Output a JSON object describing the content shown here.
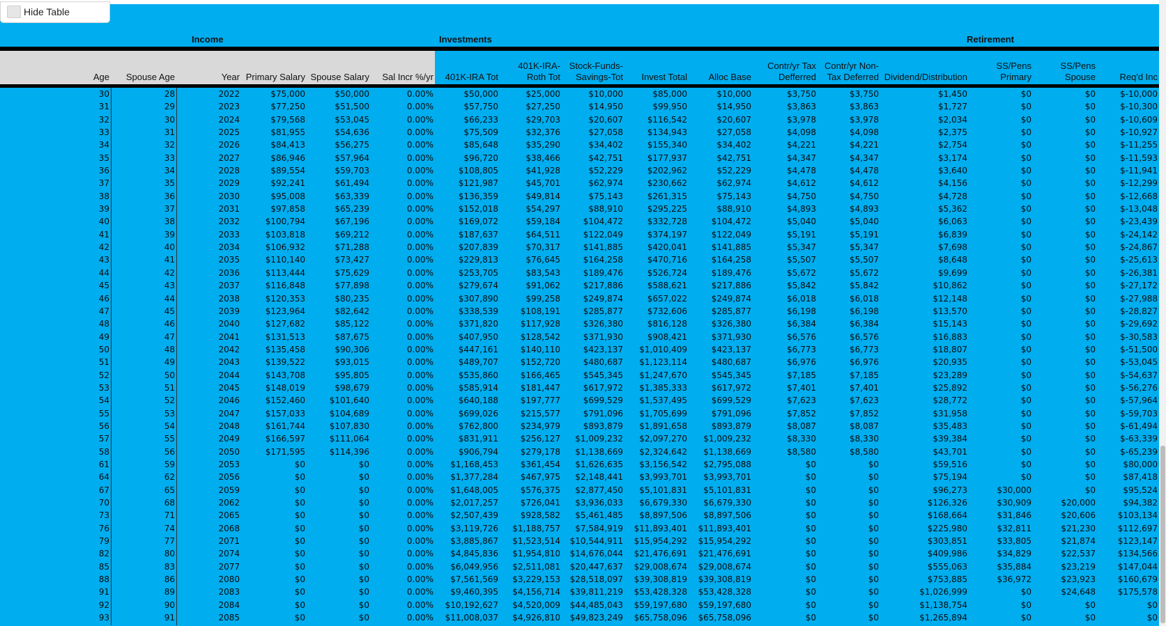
{
  "toolbar": {
    "hide_table_label": "Hide Table"
  },
  "sections": {
    "income": "Income",
    "investments": "Investments",
    "retirement": "Retirement"
  },
  "columns": [
    "Age",
    "Spouse Age",
    "Year",
    "Primary Salary",
    "Spouse Salary",
    "Sal Incr %/yr",
    "401K-IRA Tot",
    "401K-IRA-\nRoth Tot",
    "Stock-Funds-\nSavings-Tot",
    "Invest Total",
    "Alloc Base",
    "Contr/yr Tax\nDefferred",
    "Contr/yr Non-\nTax Deferred",
    "Dividend/Distribution",
    "SS/Pens\nPrimary",
    "SS/Pens\nSpouse",
    "Req'd Inc"
  ],
  "rows": [
    [
      "30",
      "28",
      "2022",
      "$75,000",
      "$50,000",
      "0.00%",
      "$50,000",
      "$25,000",
      "$10,000",
      "$85,000",
      "$10,000",
      "$3,750",
      "$3,750",
      "$1,450",
      "$0",
      "$0",
      "$-10,000"
    ],
    [
      "31",
      "29",
      "2023",
      "$77,250",
      "$51,500",
      "0.00%",
      "$57,750",
      "$27,250",
      "$14,950",
      "$99,950",
      "$14,950",
      "$3,863",
      "$3,863",
      "$1,727",
      "$0",
      "$0",
      "$-10,300"
    ],
    [
      "32",
      "30",
      "2024",
      "$79,568",
      "$53,045",
      "0.00%",
      "$66,233",
      "$29,703",
      "$20,607",
      "$116,542",
      "$20,607",
      "$3,978",
      "$3,978",
      "$2,034",
      "$0",
      "$0",
      "$-10,609"
    ],
    [
      "33",
      "31",
      "2025",
      "$81,955",
      "$54,636",
      "0.00%",
      "$75,509",
      "$32,376",
      "$27,058",
      "$134,943",
      "$27,058",
      "$4,098",
      "$4,098",
      "$2,375",
      "$0",
      "$0",
      "$-10,927"
    ],
    [
      "34",
      "32",
      "2026",
      "$84,413",
      "$56,275",
      "0.00%",
      "$85,648",
      "$35,290",
      "$34,402",
      "$155,340",
      "$34,402",
      "$4,221",
      "$4,221",
      "$2,754",
      "$0",
      "$0",
      "$-11,255"
    ],
    [
      "35",
      "33",
      "2027",
      "$86,946",
      "$57,964",
      "0.00%",
      "$96,720",
      "$38,466",
      "$42,751",
      "$177,937",
      "$42,751",
      "$4,347",
      "$4,347",
      "$3,174",
      "$0",
      "$0",
      "$-11,593"
    ],
    [
      "36",
      "34",
      "2028",
      "$89,554",
      "$59,703",
      "0.00%",
      "$108,805",
      "$41,928",
      "$52,229",
      "$202,962",
      "$52,229",
      "$4,478",
      "$4,478",
      "$3,640",
      "$0",
      "$0",
      "$-11,941"
    ],
    [
      "37",
      "35",
      "2029",
      "$92,241",
      "$61,494",
      "0.00%",
      "$121,987",
      "$45,701",
      "$62,974",
      "$230,662",
      "$62,974",
      "$4,612",
      "$4,612",
      "$4,156",
      "$0",
      "$0",
      "$-12,299"
    ],
    [
      "38",
      "36",
      "2030",
      "$95,008",
      "$63,339",
      "0.00%",
      "$136,359",
      "$49,814",
      "$75,143",
      "$261,315",
      "$75,143",
      "$4,750",
      "$4,750",
      "$4,728",
      "$0",
      "$0",
      "$-12,668"
    ],
    [
      "39",
      "37",
      "2031",
      "$97,858",
      "$65,239",
      "0.00%",
      "$152,018",
      "$54,297",
      "$88,910",
      "$295,225",
      "$88,910",
      "$4,893",
      "$4,893",
      "$5,362",
      "$0",
      "$0",
      "$-13,048"
    ],
    [
      "40",
      "38",
      "2032",
      "$100,794",
      "$67,196",
      "0.00%",
      "$169,072",
      "$59,184",
      "$104,472",
      "$332,728",
      "$104,472",
      "$5,040",
      "$5,040",
      "$6,063",
      "$0",
      "$0",
      "$-23,439"
    ],
    [
      "41",
      "39",
      "2033",
      "$103,818",
      "$69,212",
      "0.00%",
      "$187,637",
      "$64,511",
      "$122,049",
      "$374,197",
      "$122,049",
      "$5,191",
      "$5,191",
      "$6,839",
      "$0",
      "$0",
      "$-24,142"
    ],
    [
      "42",
      "40",
      "2034",
      "$106,932",
      "$71,288",
      "0.00%",
      "$207,839",
      "$70,317",
      "$141,885",
      "$420,041",
      "$141,885",
      "$5,347",
      "$5,347",
      "$7,698",
      "$0",
      "$0",
      "$-24,867"
    ],
    [
      "43",
      "41",
      "2035",
      "$110,140",
      "$73,427",
      "0.00%",
      "$229,813",
      "$76,645",
      "$164,258",
      "$470,716",
      "$164,258",
      "$5,507",
      "$5,507",
      "$8,648",
      "$0",
      "$0",
      "$-25,613"
    ],
    [
      "44",
      "42",
      "2036",
      "$113,444",
      "$75,629",
      "0.00%",
      "$253,705",
      "$83,543",
      "$189,476",
      "$526,724",
      "$189,476",
      "$5,672",
      "$5,672",
      "$9,699",
      "$0",
      "$0",
      "$-26,381"
    ],
    [
      "45",
      "43",
      "2037",
      "$116,848",
      "$77,898",
      "0.00%",
      "$279,674",
      "$91,062",
      "$217,886",
      "$588,621",
      "$217,886",
      "$5,842",
      "$5,842",
      "$10,862",
      "$0",
      "$0",
      "$-27,172"
    ],
    [
      "46",
      "44",
      "2038",
      "$120,353",
      "$80,235",
      "0.00%",
      "$307,890",
      "$99,258",
      "$249,874",
      "$657,022",
      "$249,874",
      "$6,018",
      "$6,018",
      "$12,148",
      "$0",
      "$0",
      "$-27,988"
    ],
    [
      "47",
      "45",
      "2039",
      "$123,964",
      "$82,642",
      "0.00%",
      "$338,539",
      "$108,191",
      "$285,877",
      "$732,606",
      "$285,877",
      "$6,198",
      "$6,198",
      "$13,570",
      "$0",
      "$0",
      "$-28,827"
    ],
    [
      "48",
      "46",
      "2040",
      "$127,682",
      "$85,122",
      "0.00%",
      "$371,820",
      "$117,928",
      "$326,380",
      "$816,128",
      "$326,380",
      "$6,384",
      "$6,384",
      "$15,143",
      "$0",
      "$0",
      "$-29,692"
    ],
    [
      "49",
      "47",
      "2041",
      "$131,513",
      "$87,675",
      "0.00%",
      "$407,950",
      "$128,542",
      "$371,930",
      "$908,421",
      "$371,930",
      "$6,576",
      "$6,576",
      "$16,883",
      "$0",
      "$0",
      "$-30,583"
    ],
    [
      "50",
      "48",
      "2042",
      "$135,458",
      "$90,306",
      "0.00%",
      "$447,161",
      "$140,110",
      "$423,137",
      "$1,010,409",
      "$423,137",
      "$6,773",
      "$6,773",
      "$18,807",
      "$0",
      "$0",
      "$-51,500"
    ],
    [
      "51",
      "49",
      "2043",
      "$139,522",
      "$93,015",
      "0.00%",
      "$489,707",
      "$152,720",
      "$480,687",
      "$1,123,114",
      "$480,687",
      "$6,976",
      "$6,976",
      "$20,935",
      "$0",
      "$0",
      "$-53,045"
    ],
    [
      "52",
      "50",
      "2044",
      "$143,708",
      "$95,805",
      "0.00%",
      "$535,860",
      "$166,465",
      "$545,345",
      "$1,247,670",
      "$545,345",
      "$7,185",
      "$7,185",
      "$23,289",
      "$0",
      "$0",
      "$-54,637"
    ],
    [
      "53",
      "51",
      "2045",
      "$148,019",
      "$98,679",
      "0.00%",
      "$585,914",
      "$181,447",
      "$617,972",
      "$1,385,333",
      "$617,972",
      "$7,401",
      "$7,401",
      "$25,892",
      "$0",
      "$0",
      "$-56,276"
    ],
    [
      "54",
      "52",
      "2046",
      "$152,460",
      "$101,640",
      "0.00%",
      "$640,188",
      "$197,777",
      "$699,529",
      "$1,537,495",
      "$699,529",
      "$7,623",
      "$7,623",
      "$28,772",
      "$0",
      "$0",
      "$-57,964"
    ],
    [
      "55",
      "53",
      "2047",
      "$157,033",
      "$104,689",
      "0.00%",
      "$699,026",
      "$215,577",
      "$791,096",
      "$1,705,699",
      "$791,096",
      "$7,852",
      "$7,852",
      "$31,958",
      "$0",
      "$0",
      "$-59,703"
    ],
    [
      "56",
      "54",
      "2048",
      "$161,744",
      "$107,830",
      "0.00%",
      "$762,800",
      "$234,979",
      "$893,879",
      "$1,891,658",
      "$893,879",
      "$8,087",
      "$8,087",
      "$35,483",
      "$0",
      "$0",
      "$-61,494"
    ],
    [
      "57",
      "55",
      "2049",
      "$166,597",
      "$111,064",
      "0.00%",
      "$831,911",
      "$256,127",
      "$1,009,232",
      "$2,097,270",
      "$1,009,232",
      "$8,330",
      "$8,330",
      "$39,384",
      "$0",
      "$0",
      "$-63,339"
    ],
    [
      "58",
      "56",
      "2050",
      "$171,595",
      "$114,396",
      "0.00%",
      "$906,794",
      "$279,178",
      "$1,138,669",
      "$2,324,642",
      "$1,138,669",
      "$8,580",
      "$8,580",
      "$43,701",
      "$0",
      "$0",
      "$-65,239"
    ],
    [
      "61",
      "59",
      "2053",
      "$0",
      "$0",
      "0.00%",
      "$1,168,453",
      "$361,454",
      "$1,626,635",
      "$3,156,542",
      "$2,795,088",
      "$0",
      "$0",
      "$59,516",
      "$0",
      "$0",
      "$80,000"
    ],
    [
      "64",
      "62",
      "2056",
      "$0",
      "$0",
      "0.00%",
      "$1,377,284",
      "$467,975",
      "$2,148,441",
      "$3,993,701",
      "$3,993,701",
      "$0",
      "$0",
      "$75,194",
      "$0",
      "$0",
      "$87,418"
    ],
    [
      "67",
      "65",
      "2059",
      "$0",
      "$0",
      "0.00%",
      "$1,648,005",
      "$576,375",
      "$2,877,450",
      "$5,101,831",
      "$5,101,831",
      "$0",
      "$0",
      "$96,273",
      "$30,000",
      "$0",
      "$95,524"
    ],
    [
      "70",
      "68",
      "2062",
      "$0",
      "$0",
      "0.00%",
      "$2,017,257",
      "$726,041",
      "$3,936,033",
      "$6,679,330",
      "$6,679,330",
      "$0",
      "$0",
      "$126,326",
      "$30,909",
      "$20,000",
      "$94,382"
    ],
    [
      "73",
      "71",
      "2065",
      "$0",
      "$0",
      "0.00%",
      "$2,507,439",
      "$928,582",
      "$5,461,485",
      "$8,897,506",
      "$8,897,506",
      "$0",
      "$0",
      "$168,664",
      "$31,846",
      "$20,606",
      "$103,134"
    ],
    [
      "76",
      "74",
      "2068",
      "$0",
      "$0",
      "0.00%",
      "$3,119,726",
      "$1,188,757",
      "$7,584,919",
      "$11,893,401",
      "$11,893,401",
      "$0",
      "$0",
      "$225,980",
      "$32,811",
      "$21,230",
      "$112,697"
    ],
    [
      "79",
      "77",
      "2071",
      "$0",
      "$0",
      "0.00%",
      "$3,885,867",
      "$1,523,514",
      "$10,544,911",
      "$15,954,292",
      "$15,954,292",
      "$0",
      "$0",
      "$303,851",
      "$33,805",
      "$21,874",
      "$123,147"
    ],
    [
      "82",
      "80",
      "2074",
      "$0",
      "$0",
      "0.00%",
      "$4,845,836",
      "$1,954,810",
      "$14,676,044",
      "$21,476,691",
      "$21,476,691",
      "$0",
      "$0",
      "$409,986",
      "$34,829",
      "$22,537",
      "$134,566"
    ],
    [
      "85",
      "83",
      "2077",
      "$0",
      "$0",
      "0.00%",
      "$6,049,956",
      "$2,511,081",
      "$20,447,637",
      "$29,008,674",
      "$29,008,674",
      "$0",
      "$0",
      "$555,063",
      "$35,884",
      "$23,219",
      "$147,044"
    ],
    [
      "88",
      "86",
      "2080",
      "$0",
      "$0",
      "0.00%",
      "$7,561,569",
      "$3,229,153",
      "$28,518,097",
      "$39,308,819",
      "$39,308,819",
      "$0",
      "$0",
      "$753,885",
      "$36,972",
      "$23,923",
      "$160,679"
    ],
    [
      "91",
      "89",
      "2083",
      "$0",
      "$0",
      "0.00%",
      "$9,460,395",
      "$4,156,714",
      "$39,811,219",
      "$53,428,328",
      "$53,428,328",
      "$0",
      "$0",
      "$1,026,999",
      "$0",
      "$24,648",
      "$175,578"
    ],
    [
      "92",
      "90",
      "2084",
      "$0",
      "$0",
      "0.00%",
      "$10,192,627",
      "$4,520,009",
      "$44,485,043",
      "$59,197,680",
      "$59,197,680",
      "$0",
      "$0",
      "$1,138,754",
      "$0",
      "$0",
      "$0"
    ],
    [
      "93",
      "91",
      "2085",
      "$0",
      "$0",
      "0.00%",
      "$11,008,037",
      "$4,926,810",
      "$49,823,249",
      "$65,758,096",
      "$65,758,096",
      "$0",
      "$0",
      "$1,265,894",
      "$0",
      "$0",
      "$0"
    ]
  ]
}
